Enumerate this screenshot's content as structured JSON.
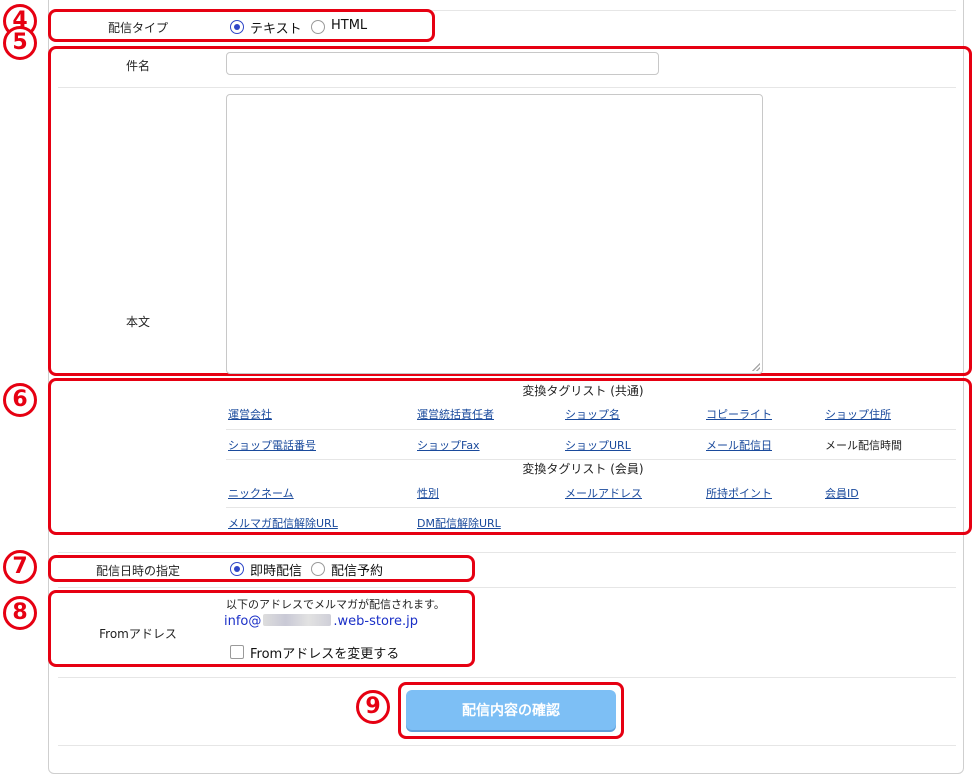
{
  "steps": {
    "s4": "4",
    "s5": "5",
    "s6": "6",
    "s7": "7",
    "s8": "8",
    "s9": "9"
  },
  "delivery_type": {
    "label": "配信タイプ",
    "options": [
      {
        "label": "テキスト",
        "selected": true
      },
      {
        "label": "HTML",
        "selected": false
      }
    ]
  },
  "subject": {
    "label": "件名",
    "value": ""
  },
  "body": {
    "label": "本文",
    "value": ""
  },
  "tag_list": {
    "common_heading": "変換タグリスト (共通)",
    "common_tags": [
      "運営会社",
      "運営統括責任者",
      "ショップ名",
      "コピーライト",
      "ショップ住所",
      "ショップ電話番号",
      "ショップFax",
      "ショップURL",
      "メール配信日",
      "メール配信時間"
    ],
    "member_heading": "変換タグリスト (会員)",
    "member_tags": [
      "ニックネーム",
      "性別",
      "メールアドレス",
      "所持ポイント",
      "会員ID",
      "メルマガ配信解除URL",
      "DM配信解除URL"
    ]
  },
  "schedule": {
    "label": "配信日時の指定",
    "options": [
      {
        "label": "即時配信",
        "selected": true
      },
      {
        "label": "配信予約",
        "selected": false
      }
    ]
  },
  "from_address": {
    "label": "Fromアドレス",
    "note": "以下のアドレスでメルマガが配信されます。",
    "address_prefix": "info@",
    "address_suffix": ".web-store.jp",
    "change_label": "Fromアドレスを変更する",
    "change_checked": false
  },
  "confirm_button": "配信内容の確認",
  "colors": {
    "accent_red": "#e60012",
    "button": "#7dbff5",
    "link": "#1a4a9c",
    "radio": "#2f46c7"
  }
}
